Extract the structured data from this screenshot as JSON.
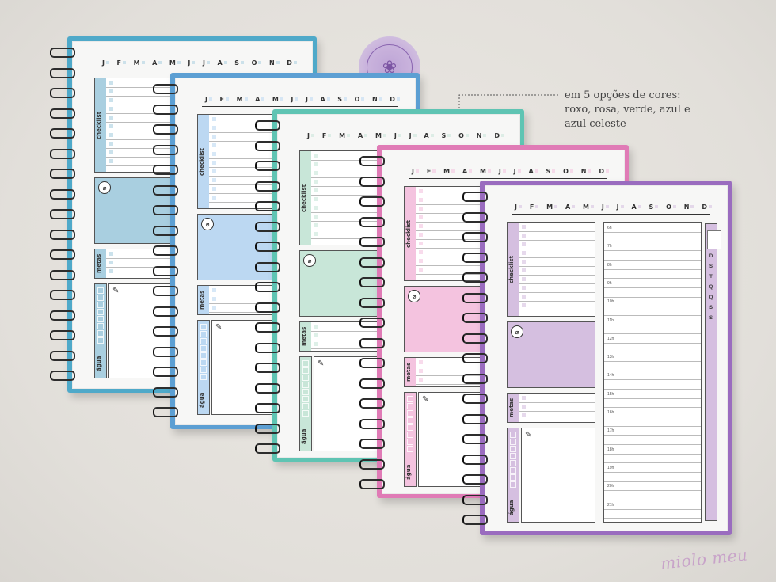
{
  "caption": {
    "line1": "em 5 opções de cores:",
    "line2": "roxo, rosa, verde, azul e",
    "line3": "azul celeste"
  },
  "brand": "miolo meu",
  "months": [
    "J",
    "F",
    "M",
    "A",
    "M",
    "J",
    "J",
    "A",
    "S",
    "O",
    "N",
    "D"
  ],
  "labels": {
    "checklist": "checklist",
    "metas": "metas",
    "agua": "água"
  },
  "weekdays": [
    "D",
    "S",
    "T",
    "Q",
    "Q",
    "S",
    "S"
  ],
  "hours": [
    "6h",
    "7h",
    "8h",
    "9h",
    "10h",
    "11h",
    "12h",
    "13h",
    "14h",
    "15h",
    "16h",
    "17h",
    "18h",
    "19h",
    "20h",
    "21h"
  ],
  "stamp_icon": "book-stamp-icon",
  "colors": {
    "azul_celeste": "#a9cfe0",
    "azul": "#bcd8f2",
    "verde": "#c8e6d8",
    "rosa": "#f4c3df",
    "roxo": "#d5bfe0",
    "cover_celeste": "#4fa9c9",
    "cover_azul": "#5c9fd3",
    "cover_verde": "#5fc4b3",
    "cover_rosa": "#e07bb6",
    "cover_roxo": "#9a6cbf"
  }
}
